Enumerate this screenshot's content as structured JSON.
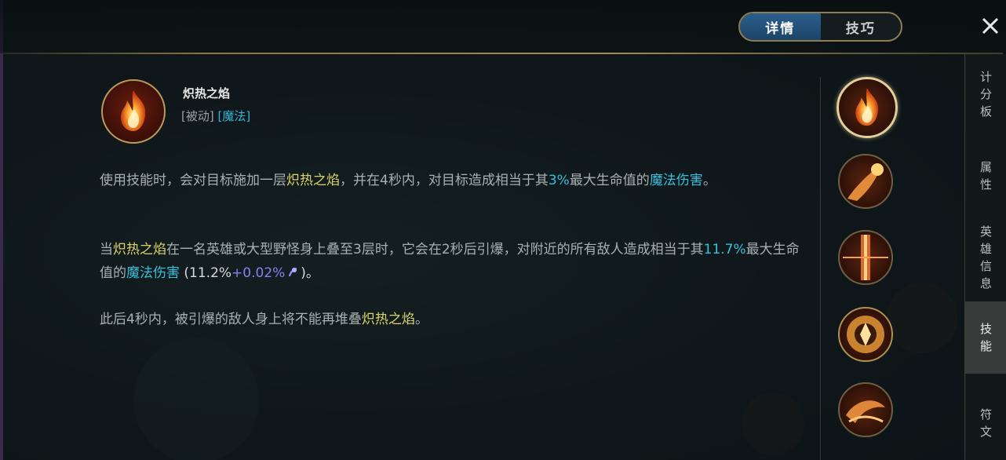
{
  "tabs": [
    {
      "label": "详情",
      "active": true
    },
    {
      "label": "技巧",
      "active": false
    }
  ],
  "skill": {
    "name": "炽热之焰",
    "tag_passive": "[被动]",
    "tag_magic": "[魔法]"
  },
  "description": {
    "p1": {
      "a": "使用技能时，会对目标施加一层",
      "b": "炽热之焰",
      "c": "，并在4秒内，对目标造成相当于其",
      "d": "3%",
      "e": "最大生命值的",
      "f": "魔法伤害",
      "g": "。"
    },
    "p2": {
      "a": "当",
      "b": "炽热之焰",
      "c": "在一名英雄或大型野怪身上叠至3层时，它会在2秒后引爆，对附近的所有敌人造成相当于其",
      "d": "11.7%",
      "e": "最大生命值的",
      "f": "魔法伤害",
      "g": " (11.2%",
      "h": "+0.02%",
      "i": ")。"
    },
    "p3": {
      "a": "此后4秒内，被引爆的敌人身上将不能再堆叠",
      "b": "炽热之焰",
      "c": "。"
    }
  },
  "right_nav": [
    {
      "label": "计\n分\n板",
      "active": false
    },
    {
      "label": "属\n性",
      "active": false
    },
    {
      "label": "英\n雄\n信\n息",
      "active": false
    },
    {
      "label": "技\n能",
      "active": true
    },
    {
      "label": "符\n文",
      "active": false
    }
  ],
  "icons": {
    "close": "close-icon",
    "passive": "fire-icon",
    "ap": "ability-power-icon"
  },
  "colors": {
    "accent_gold": "#8d7d55",
    "tab_active": "#2a5f8c",
    "highlight_yellow": "#d9d56c",
    "highlight_cyan": "#32c1de",
    "highlight_purple": "#8a7ff0"
  }
}
